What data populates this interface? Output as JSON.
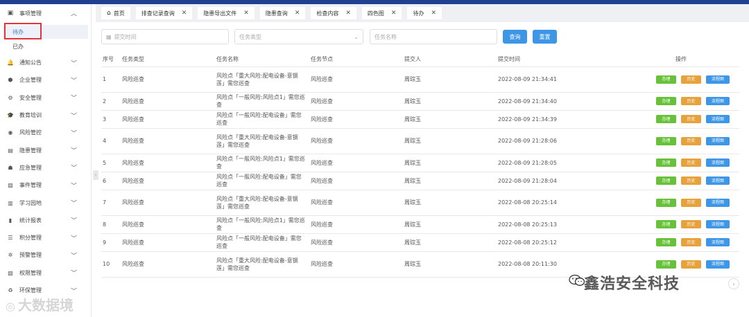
{
  "sidebar": {
    "open_menu": {
      "label": "事项管理",
      "icon": "document-icon"
    },
    "sub_items": [
      {
        "label": "待办",
        "active": true
      },
      {
        "label": "已办",
        "active": false
      }
    ],
    "items": [
      {
        "label": "通知公告",
        "icon": "bell-icon"
      },
      {
        "label": "企业管理",
        "icon": "shield-icon"
      },
      {
        "label": "安全管理",
        "icon": "gear-icon"
      },
      {
        "label": "教育培训",
        "icon": "graduation-cap-icon"
      },
      {
        "label": "风险管控",
        "icon": "target-icon"
      },
      {
        "label": "隐患管理",
        "icon": "stack-icon"
      },
      {
        "label": "应急管理",
        "icon": "user-alert-icon"
      },
      {
        "label": "事件管理",
        "icon": "clipboard-icon"
      },
      {
        "label": "学习园地",
        "icon": "book-icon"
      },
      {
        "label": "统计报表",
        "icon": "bar-chart-icon"
      },
      {
        "label": "积分管理",
        "icon": "database-icon"
      },
      {
        "label": "预警管理",
        "icon": "cog-icon"
      },
      {
        "label": "权限管理",
        "icon": "key-icon"
      },
      {
        "label": "环保管理",
        "icon": "recycle-icon"
      }
    ]
  },
  "tabs": [
    {
      "label": "首页",
      "closable": false,
      "home": true
    },
    {
      "label": "排查记录查询",
      "closable": true
    },
    {
      "label": "隐患导出文件",
      "closable": true
    },
    {
      "label": "隐患查询",
      "closable": true
    },
    {
      "label": "检查内容",
      "closable": true
    },
    {
      "label": "四色图",
      "closable": true
    },
    {
      "label": "待办",
      "closable": true
    }
  ],
  "filters": {
    "submit_time_placeholder": "提交时间",
    "task_type_placeholder": "任务类型",
    "task_name_placeholder": "任务名称",
    "search_label": "查询",
    "reset_label": "重置"
  },
  "table": {
    "headers": [
      "序号",
      "任务类型",
      "任务名称",
      "任务节点",
      "提交人",
      "提交时间",
      "操作"
    ],
    "op_labels": {
      "handle": "办理",
      "history": "历史",
      "flow": "流程图"
    },
    "rows": [
      {
        "no": "1",
        "type": "风险巡查",
        "name": "风险点「重大风险:配电设备-意钢莲」需您巡查",
        "node": "风险巡查",
        "submitter": "周琮玉",
        "time": "2022-08-09 21:34:41"
      },
      {
        "no": "2",
        "type": "风险巡查",
        "name": "风险点「一般风险:风险点1」需您巡查",
        "node": "风险巡查",
        "submitter": "周琮玉",
        "time": "2022-08-09 21:34:40"
      },
      {
        "no": "3",
        "type": "风险巡查",
        "name": "风险点「一般风险:配电设备」需您巡查",
        "node": "风险巡查",
        "submitter": "周琮玉",
        "time": "2022-08-09 21:34:39"
      },
      {
        "no": "4",
        "type": "风险巡查",
        "name": "风险点「重大风险:配电设备-意钢莲」需您巡查",
        "node": "风险巡查",
        "submitter": "周琮玉",
        "time": "2022-08-09 21:28:06"
      },
      {
        "no": "5",
        "type": "风险巡查",
        "name": "风险点「一般风险:风险点1」需您巡查",
        "node": "风险巡查",
        "submitter": "周琮玉",
        "time": "2022-08-09 21:28:05"
      },
      {
        "no": "6",
        "type": "风险巡查",
        "name": "风险点「一般风险:配电设备」需您巡查",
        "node": "风险巡查",
        "submitter": "周琮玉",
        "time": "2022-08-09 21:28:04"
      },
      {
        "no": "7",
        "type": "风险巡查",
        "name": "风险点「重大风险:配电设备-意钢莲」需您巡查",
        "node": "风险巡查",
        "submitter": "周琮玉",
        "time": "2022-08-08 20:25:14"
      },
      {
        "no": "8",
        "type": "风险巡查",
        "name": "风险点「一般风险:风险点1」需您巡查",
        "node": "风险巡查",
        "submitter": "周琮玉",
        "time": "2022-08-08 20:25:13"
      },
      {
        "no": "9",
        "type": "风险巡查",
        "name": "风险点「一般风险:配电设备」需您巡查",
        "node": "风险巡查",
        "submitter": "周琮玉",
        "time": "2022-08-08 20:25:12"
      },
      {
        "no": "10",
        "type": "风险巡查",
        "name": "风险点「重大风险:配电设备-意钢莲」需您巡查",
        "node": "风险巡查",
        "submitter": "周琮玉",
        "time": "2022-08-08 20:11:30"
      }
    ]
  },
  "watermarks": {
    "left": "大数据境",
    "right": "鑫浩安全科技"
  },
  "colors": {
    "topbar": "#1f3f8f",
    "primary": "#3d96e6",
    "success": "#67c23a",
    "warning": "#e6a23c",
    "highlight_border": "#e0343a"
  }
}
